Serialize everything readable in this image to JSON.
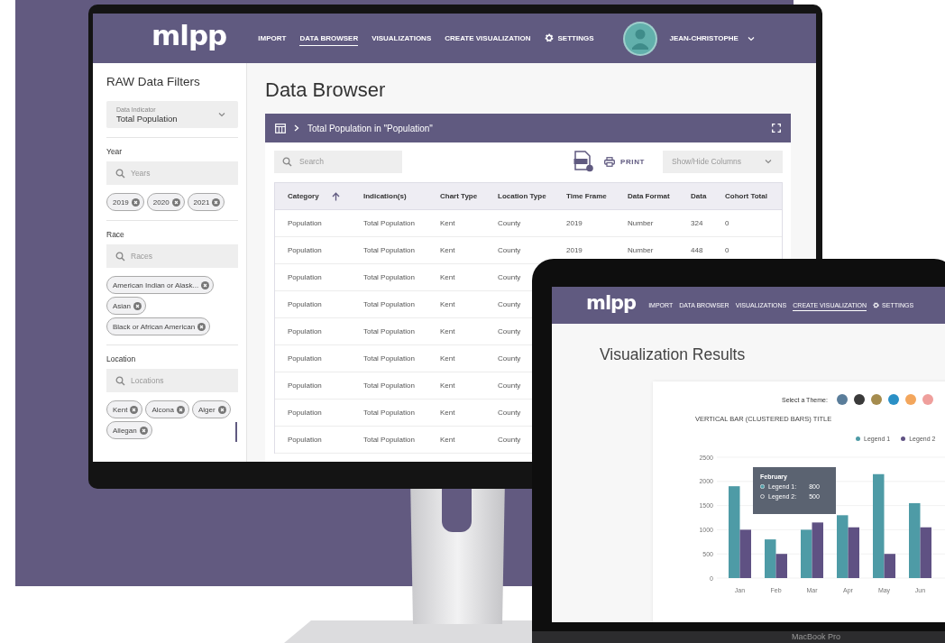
{
  "monitor": {
    "nav": {
      "logo": "mlpp",
      "items": [
        {
          "label": "IMPORT",
          "kind": "link",
          "selected": false
        },
        {
          "label": "DATA BROWSER",
          "kind": "link",
          "selected": true
        },
        {
          "label": "VISUALIZATIONS",
          "kind": "link",
          "selected": false
        },
        {
          "label": "CREATE VISUALIZATION",
          "kind": "link",
          "selected": false
        },
        {
          "label": "SETTINGS",
          "kind": "settings",
          "selected": false
        }
      ],
      "user": "JEAN-CHRISTOPHE"
    },
    "sidebar": {
      "title": "RAW Data Filters",
      "indicator": {
        "label": "Data Indicator",
        "value": "Total Population"
      },
      "filters": [
        {
          "label": "Year",
          "placeholder": "Years",
          "chips": [
            "2019",
            "2020",
            "2021"
          ]
        },
        {
          "label": "Race",
          "placeholder": "Races",
          "chips": [
            "American Indian or Alask...",
            "Asian",
            "Black or African American"
          ]
        },
        {
          "label": "Location",
          "placeholder": "Locations",
          "chips": [
            "Kent",
            "Alcona",
            "Alger",
            "Allegan"
          ]
        }
      ]
    },
    "main": {
      "title": "Data Browser",
      "panel": {
        "breadcrumb": "Total Population in \"Population\"",
        "search": {
          "placeholder": "Search"
        },
        "print": "PRINT",
        "columns_button": "Show/Hide Columns",
        "table": {
          "columns": [
            {
              "label": "Category",
              "sorted": true
            },
            {
              "label": "Indication(s)",
              "sorted": false
            },
            {
              "label": "Chart Type",
              "sorted": false
            },
            {
              "label": "Location Type",
              "sorted": false
            },
            {
              "label": "Time Frame",
              "sorted": false
            },
            {
              "label": "Data Format",
              "sorted": false
            },
            {
              "label": "Data",
              "sorted": false
            },
            {
              "label": "Cohort Total",
              "sorted": false
            }
          ],
          "rows": [
            [
              "Population",
              "Total Population",
              "Kent",
              "County",
              "2019",
              "Number",
              "324",
              "0"
            ],
            [
              "Population",
              "Total Population",
              "Kent",
              "County",
              "2019",
              "Number",
              "448",
              "0"
            ],
            [
              "Population",
              "Total Population",
              "Kent",
              "County"
            ],
            [
              "Population",
              "Total Population",
              "Kent",
              "County"
            ],
            [
              "Population",
              "Total Population",
              "Kent",
              "County"
            ],
            [
              "Population",
              "Total Population",
              "Kent",
              "County"
            ],
            [
              "Population",
              "Total Population",
              "Kent",
              "County"
            ],
            [
              "Population",
              "Total Population",
              "Kent",
              "County"
            ],
            [
              "Population",
              "Total Population",
              "Kent",
              "County"
            ]
          ]
        }
      }
    }
  },
  "laptop": {
    "nav": {
      "logo": "mlpp",
      "items": [
        {
          "label": "IMPORT",
          "kind": "link",
          "selected": false
        },
        {
          "label": "DATA BROWSER",
          "kind": "link",
          "selected": false
        },
        {
          "label": "VISUALIZATIONS",
          "kind": "link",
          "selected": false
        },
        {
          "label": "CREATE VISUALIZATION",
          "kind": "link",
          "selected": true
        },
        {
          "label": "SETTINGS",
          "kind": "settings",
          "selected": false
        }
      ]
    },
    "title": "Visualization Results",
    "card": {
      "theme_label": "Select a Theme:",
      "themes": [
        {
          "color": "#5a7d9a"
        },
        {
          "color": "#3a3a3a"
        },
        {
          "color": "#a58c4e"
        },
        {
          "color": "#2a90c6"
        },
        {
          "color": "#f3a65c"
        },
        {
          "color": "#ef9f9c"
        }
      ],
      "chart_data": {
        "type": "bar",
        "title": "VERTICAL BAR (CLUSTERED BARS) TITLE",
        "categories": [
          "Jan",
          "Feb",
          "Mar",
          "Apr",
          "May",
          "Jun"
        ],
        "series": [
          {
            "name": "Legend 1",
            "color": "#4e9ba6",
            "values": [
              1900,
              800,
              1000,
              1300,
              2150,
              1550
            ]
          },
          {
            "name": "Legend 2",
            "color": "#5f5183",
            "values": [
              1000,
              500,
              1150,
              1050,
              500,
              1050
            ]
          }
        ],
        "ylim": [
          0,
          2500
        ],
        "yticks": [
          0,
          500,
          1000,
          1500,
          2000,
          2500
        ],
        "grid": true
      },
      "tooltip": {
        "title": "February",
        "rows": [
          {
            "label": "Legend 1:",
            "value": "800"
          },
          {
            "label": "Legend 2:",
            "value": "500"
          }
        ]
      }
    },
    "brand": "MacBook Pro"
  }
}
